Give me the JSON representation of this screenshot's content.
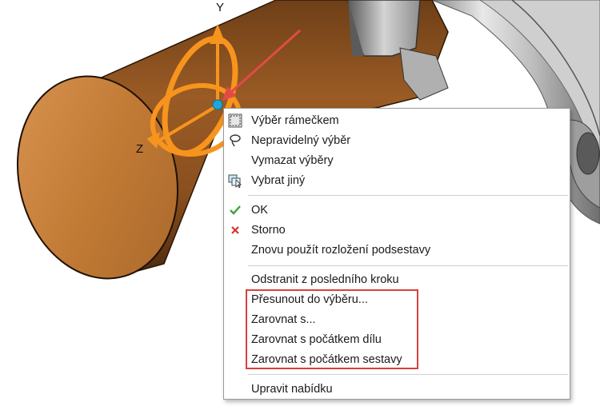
{
  "viewport": {
    "axis_labels": {
      "y": "Y",
      "z": "Z"
    },
    "colors": {
      "part": "#c07a34",
      "triad": "#f7941d",
      "origin_dot": "#1fa5d8",
      "arrow": "#e14b46"
    }
  },
  "context_menu": {
    "items": [
      {
        "label": "Výběr rámečkem",
        "icon": "box-select-icon"
      },
      {
        "label": "Nepravidelný výběr",
        "icon": "lasso-select-icon"
      },
      {
        "label": "Vymazat výběry",
        "icon": ""
      },
      {
        "label": "Vybrat jiný",
        "icon": "select-other-icon"
      },
      {
        "label": "OK",
        "icon": "check-icon"
      },
      {
        "label": "Storno",
        "icon": "cancel-x-icon"
      },
      {
        "label": "Znovu použít rozložení podsestavy",
        "icon": ""
      },
      {
        "label": "Odstranit z posledního kroku",
        "icon": ""
      },
      {
        "label": "Přesunout do výběru...",
        "icon": ""
      },
      {
        "label": "Zarovnat s...",
        "icon": ""
      },
      {
        "label": "Zarovnat s počátkem dílu",
        "icon": ""
      },
      {
        "label": "Zarovnat s počátkem sestavy",
        "icon": ""
      },
      {
        "label": "Upravit nabídku",
        "icon": ""
      }
    ],
    "highlight_color": "#d9413b"
  }
}
